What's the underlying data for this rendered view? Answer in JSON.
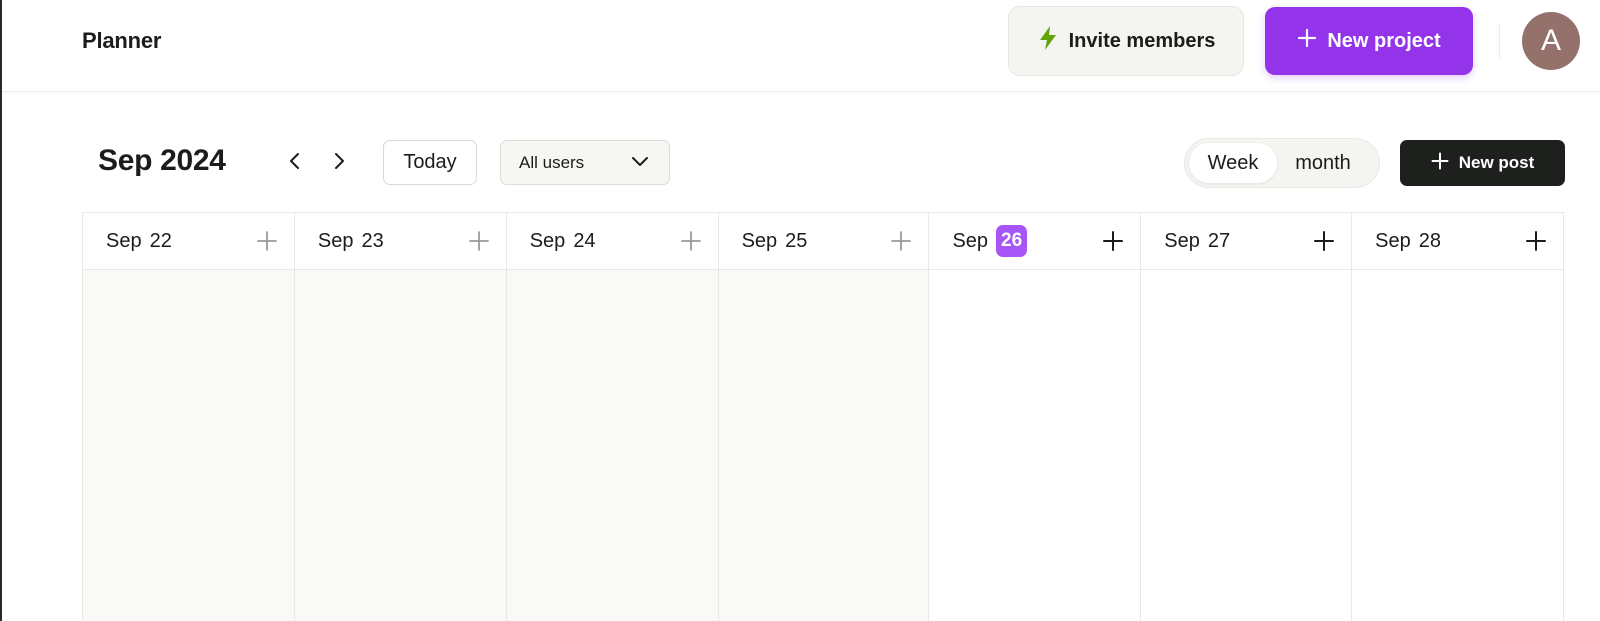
{
  "header": {
    "title": "Planner",
    "invite_label": "Invite members",
    "new_project_label": "New project",
    "avatar_initial": "A"
  },
  "toolbar": {
    "month_label": "Sep 2024",
    "today_label": "Today",
    "users_filter": "All users",
    "view_week": "Week",
    "view_month": "month",
    "active_view": "Week",
    "new_post_label": "New post"
  },
  "days": [
    {
      "month": "Sep",
      "day": "22",
      "state": "past"
    },
    {
      "month": "Sep",
      "day": "23",
      "state": "past"
    },
    {
      "month": "Sep",
      "day": "24",
      "state": "past"
    },
    {
      "month": "Sep",
      "day": "25",
      "state": "past"
    },
    {
      "month": "Sep",
      "day": "26",
      "state": "today"
    },
    {
      "month": "Sep",
      "day": "27",
      "state": "future"
    },
    {
      "month": "Sep",
      "day": "28",
      "state": "future"
    }
  ],
  "colors": {
    "accent_purple": "#9333ea",
    "today_badge": "#a855f7",
    "bolt_green": "#65a30d",
    "dark_button": "#1e201d",
    "avatar_bg": "#94716a",
    "past_day_bg": "#f9f9f7"
  },
  "icons": [
    "bolt-icon",
    "plus-icon",
    "chevron-left-icon",
    "chevron-right-icon",
    "chevron-down-icon"
  ]
}
